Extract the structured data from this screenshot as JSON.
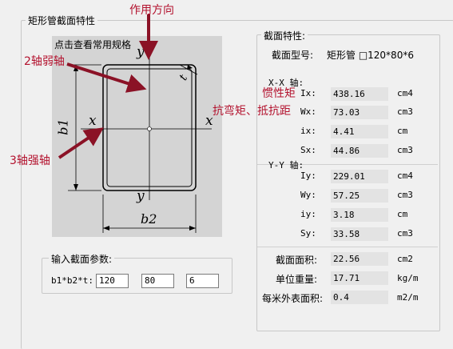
{
  "main_group": {
    "title": "矩形管截面特性"
  },
  "diagram": {
    "link": "点击查看常用规格",
    "axis_labels": {
      "x_left": "x",
      "x_right": "x",
      "y_top": "y",
      "y_bottom": "y"
    },
    "dim_labels": {
      "b1": "b1",
      "b2": "b2",
      "t": "t"
    }
  },
  "annotations": {
    "direction": "作用方向",
    "weak_axis": "2轴弱轴",
    "strong_axis": "3轴强轴",
    "inertia": "惯性矩",
    "modulus": "抗弯矩、抵抗距"
  },
  "input_group": {
    "title": "输入截面参数:",
    "label": "b1*b2*t:",
    "b1": "120",
    "b2": "80",
    "t": "6"
  },
  "props": {
    "title": "截面特性:",
    "type_label": "截面型号:",
    "type_value": "矩形管 □120*80*6",
    "xx": {
      "title": "X-X 轴:",
      "rows": [
        {
          "label": "Ix:",
          "value": "438.16",
          "unit": "cm4"
        },
        {
          "label": "Wx:",
          "value": "73.03",
          "unit": "cm3"
        },
        {
          "label": "ix:",
          "value": "4.41",
          "unit": "cm"
        },
        {
          "label": "Sx:",
          "value": "44.86",
          "unit": "cm3"
        }
      ]
    },
    "yy": {
      "title": "Y-Y 轴:",
      "rows": [
        {
          "label": "Iy:",
          "value": "229.01",
          "unit": "cm4"
        },
        {
          "label": "Wy:",
          "value": "57.25",
          "unit": "cm3"
        },
        {
          "label": "iy:",
          "value": "3.18",
          "unit": "cm"
        },
        {
          "label": "Sy:",
          "value": "33.58",
          "unit": "cm3"
        }
      ]
    },
    "area": {
      "label": "截面面积:",
      "value": "22.56",
      "unit": "cm2"
    },
    "weight": {
      "label": "单位重量:",
      "value": "17.71",
      "unit": "kg/m"
    },
    "surface": {
      "label": "每米外表面积:",
      "value": "0.4",
      "unit": "m2/m"
    }
  },
  "colors": {
    "annotation": "#b3122e",
    "diagram_bg": "#d4d4d4",
    "value_bg": "#e3e3e3"
  }
}
